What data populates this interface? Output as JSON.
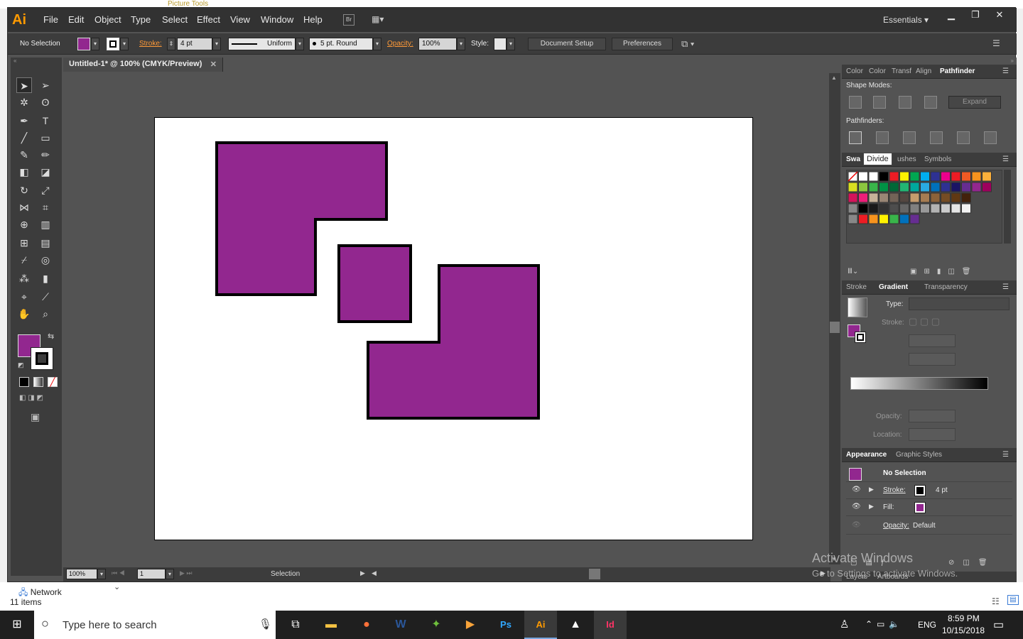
{
  "bg": {
    "picture_tools": "Picture Tools"
  },
  "menubar": {
    "items": [
      "File",
      "Edit",
      "Object",
      "Type",
      "Select",
      "Effect",
      "View",
      "Window",
      "Help"
    ],
    "workspace": "Essentials",
    "bridge_label": "Br"
  },
  "control": {
    "selection": "No Selection",
    "stroke_label": "Stroke:",
    "stroke_value": "4 pt",
    "profile": "Uniform",
    "brush": "5 pt. Round",
    "opacity_label": "Opacity:",
    "opacity_value": "100%",
    "style_label": "Style:",
    "document_setup": "Document Setup",
    "preferences": "Preferences"
  },
  "doc": {
    "tab": "Untitled-1* @ 100% (CMYK/Preview)"
  },
  "status": {
    "zoom": "100%",
    "artboard": "1",
    "tool": "Selection"
  },
  "pathfinder": {
    "tabs": [
      "Color",
      "Color",
      "Transf",
      "Align",
      "Pathfinder"
    ],
    "shape_modes": "Shape Modes:",
    "pathfinders": "Pathfinders:",
    "expand": "Expand",
    "tooltip": "Divide"
  },
  "swatches": {
    "tabs": [
      "Swa",
      "ushes",
      "Symbols"
    ]
  },
  "gradient": {
    "tabs": [
      "Stroke",
      "Gradient",
      "Transparency"
    ],
    "type_label": "Type:",
    "stroke_label": "Stroke:",
    "opacity_label": "Opacity:",
    "location_label": "Location:"
  },
  "appearance": {
    "tabs": [
      "Appearance",
      "Graphic Styles"
    ],
    "title": "No Selection",
    "stroke_label": "Stroke:",
    "stroke_value": "4 pt",
    "fill_label": "Fill:",
    "opacity_label": "Opacity:",
    "opacity_value": "Default"
  },
  "layers": {
    "tabs": [
      "Layers",
      "Artboards"
    ]
  },
  "watermark": {
    "line1": "Activate Windows",
    "line2": "Go to Settings to activate Windows."
  },
  "explorer": {
    "network": "Network",
    "items": "11 items"
  },
  "taskbar": {
    "search": "Type here to search",
    "lang": "ENG",
    "time": "8:59 PM",
    "date": "10/15/2018"
  },
  "colors": {
    "purple": "#92278f",
    "orange": "#ff9a00",
    "ui_dark": "#323232",
    "ui_mid": "#535353"
  }
}
